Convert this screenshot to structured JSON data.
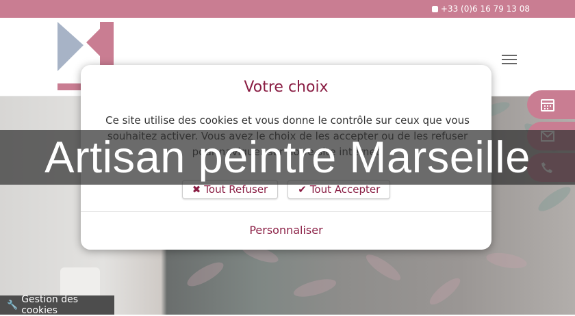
{
  "topbar": {
    "phone": "+33 (0)6 16 79 13 08",
    "phone_icon": "phone-square-icon"
  },
  "header": {
    "menu_icon": "hamburger-icon"
  },
  "side_buttons": [
    {
      "icon": "calendar-icon"
    },
    {
      "icon": "envelope-icon"
    },
    {
      "icon": "phone-icon"
    }
  ],
  "banner": {
    "title": "Artisan peintre Marseille"
  },
  "cookie_modal": {
    "title": "Votre choix",
    "text": "Ce site utilise des cookies et vous donne le contrôle sur ceux que vous souhaitez activer. Vous avez le choix de les accepter ou de les refuser pour naviguer sur notre site internet.",
    "refuse_label": "Tout Refuser",
    "accept_label": "Tout Accepter",
    "customize_label": "Personnaliser"
  },
  "cookie_tab": {
    "label": "Gestion des cookies"
  },
  "colors": {
    "accent": "#c97d92",
    "modal_text": "#8a1e44",
    "logo_blue": "#a7b3c6"
  }
}
